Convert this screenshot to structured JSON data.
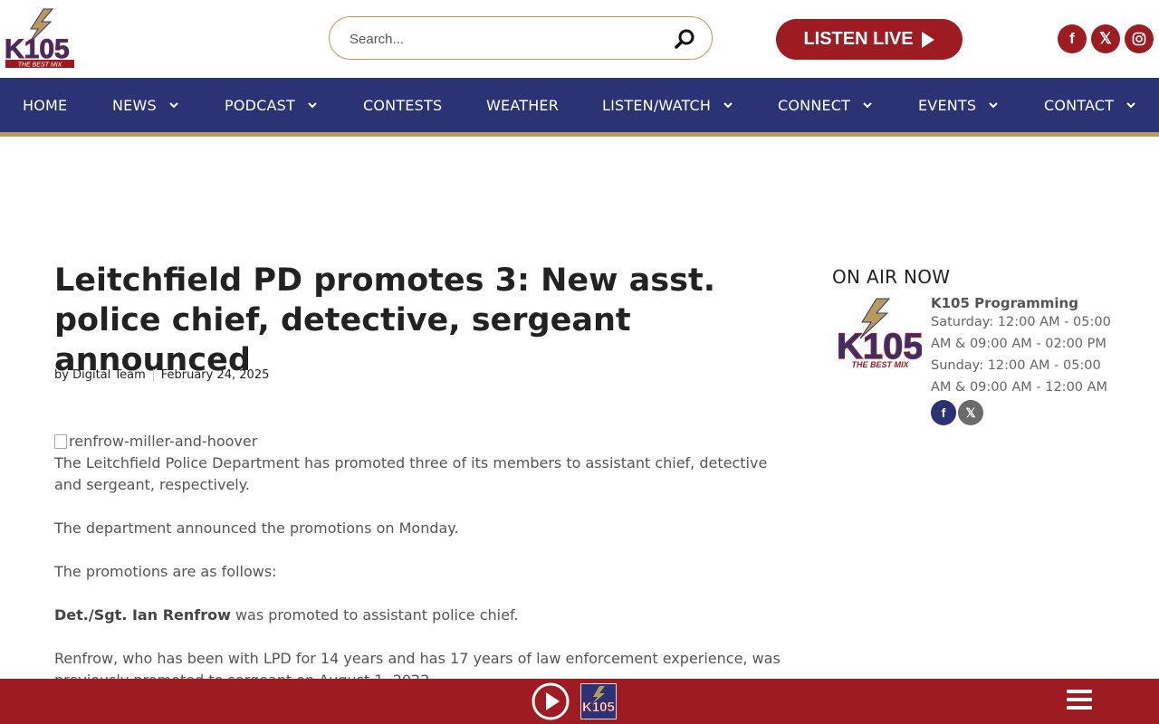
{
  "header": {
    "logo_text": "K105",
    "logo_tagline": "THE BEST MIX",
    "search_placeholder": "Search...",
    "listen_label": "LISTEN LIVE",
    "social": [
      "facebook-icon",
      "x-icon",
      "instagram-icon"
    ]
  },
  "nav": {
    "items": [
      {
        "label": "HOME",
        "dropdown": false
      },
      {
        "label": "NEWS",
        "dropdown": true
      },
      {
        "label": "PODCAST",
        "dropdown": true
      },
      {
        "label": "CONTESTS",
        "dropdown": false
      },
      {
        "label": "WEATHER",
        "dropdown": false
      },
      {
        "label": "LISTEN/WATCH",
        "dropdown": true
      },
      {
        "label": "CONNECT",
        "dropdown": true
      },
      {
        "label": "EVENTS",
        "dropdown": true
      },
      {
        "label": "CONTACT",
        "dropdown": true
      }
    ]
  },
  "article": {
    "title": "Leitchfield PD promotes 3: New asst. police chief, detective, sergeant announced",
    "author": "by Digital Team",
    "date": "February 24, 2025",
    "image_alt": "renfrow-miller-and-hoover",
    "p1": "The Leitchfield Police Department has promoted three of its members to assistant chief, detective and sergeant, respectively.",
    "p2": "The department announced the promotions on Monday.",
    "p3": "The promotions are as follows:",
    "p4_bold": "Det./Sgt. Ian Renfrow",
    "p4_rest": " was promoted to assistant police chief.",
    "p5": "Renfrow, who has been with LPD for 14 years and has 17 years of law enforcement experience, was previously promoted to sergeant on August 1, 2022."
  },
  "sidebar": {
    "heading": "ON AIR NOW",
    "show_name": "K105 Programming",
    "schedule": "Saturday: 12:00 AM - 05:00 AM & 09:00 AM - 02:00 PM Sunday: 12:00 AM - 05:00 AM & 09:00 AM - 12:00 AM"
  },
  "colors": {
    "brand_red": "#9e1b22",
    "nav_blue": "#2b3375",
    "gold": "#b99a5b"
  }
}
